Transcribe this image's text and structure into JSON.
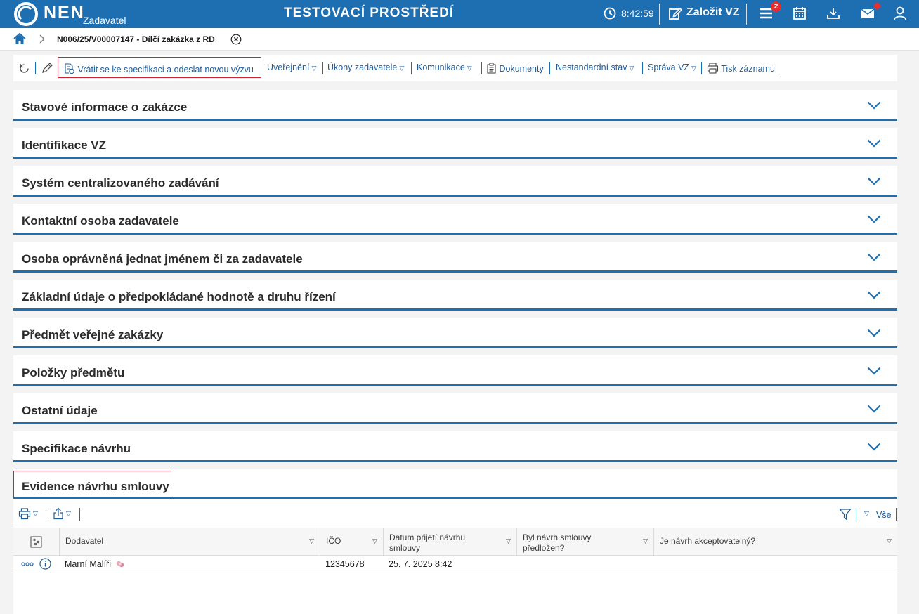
{
  "header": {
    "logo_text": "NEN",
    "logo_sub": "Zadavatel",
    "env_title": "TESTOVACÍ PROSTŘEDÍ",
    "clock": "8:42:59",
    "create_label": "Založit VZ",
    "menu_badge": "2"
  },
  "breadcrumb": {
    "title": "N006/25/V00007147 - Dílčí zakázka z RD"
  },
  "toolbar": {
    "return_label": "Vrátit se ke specifikaci a odeslat novou výzvu",
    "publish_label": "Uveřejnění",
    "actions_label": "Úkony zadavatele",
    "communication_label": "Komunikace",
    "documents_label": "Dokumenty",
    "nonstandard_label": "Nestandardní stav",
    "management_label": "Správa VZ",
    "print_label": "Tisk záznamu"
  },
  "sections": [
    "Stavové informace o zakázce",
    "Identifikace VZ",
    "Systém centralizovaného zadávání",
    "Kontaktní osoba zadavatele",
    "Osoba oprávněná jednat jménem či za zadavatele",
    "Základní údaje o předpokládané hodnotě a druhu řízení",
    "Předmět veřejné zakázky",
    "Položky předmětu",
    "Ostatní údaje",
    "Specifikace návrhu"
  ],
  "evidence": {
    "title": "Evidence návrhu smlouvy",
    "filter_all": "Vše",
    "columns": {
      "supplier": "Dodavatel",
      "ico": "IČO",
      "date_line1": "Datum přijetí návrhu",
      "date_line2": "smlouvy",
      "submitted_line1": "Byl návrh smlouvy",
      "submitted_line2": "předložen?",
      "acceptable": "Je návrh akceptovatelný?"
    },
    "rows": [
      {
        "supplier": "Marní Malíři",
        "ico": "12345678",
        "date": "25. 7. 2025 8:42",
        "submitted": "",
        "acceptable": ""
      }
    ]
  },
  "colors": {
    "brand": "#1e6fb2",
    "highlight": "#d0202f",
    "badge": "#e62e2e"
  }
}
